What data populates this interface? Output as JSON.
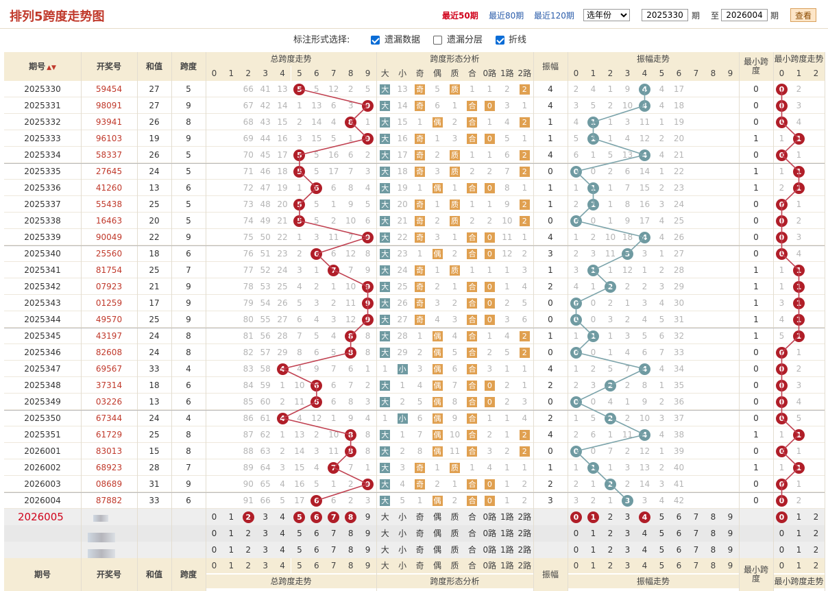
{
  "header": {
    "title": "排列5跨度走势图",
    "links": [
      "最近50期",
      "最近80期",
      "最近120期"
    ],
    "year_select": "选年份",
    "from_value": "2025330",
    "from_unit": "期",
    "to_label": "至",
    "to_value": "2026004",
    "to_unit": "期",
    "query_button": "查看"
  },
  "options": {
    "label": "标注形式选择:",
    "items": [
      {
        "label": "遗漏数据",
        "checked": true
      },
      {
        "label": "遗漏分层",
        "checked": false
      },
      {
        "label": "折线",
        "checked": true
      }
    ]
  },
  "columns": {
    "period": "期号",
    "draw": "开奖号",
    "sum": "和值",
    "span": "跨度",
    "span_trend": "总跨度走势",
    "shape": "跨度形态分析",
    "shape_cols": [
      "大",
      "小",
      "奇",
      "偶",
      "质",
      "合",
      "0路",
      "1路",
      "2路"
    ],
    "amplitude": "振幅",
    "amp_trend": "振幅走势",
    "min_span": "最小跨度",
    "min_trend": "最小跨度走势",
    "digits10": [
      "0",
      "1",
      "2",
      "3",
      "4",
      "5",
      "6",
      "7",
      "8",
      "9"
    ],
    "digits3": [
      "0",
      "1",
      "2"
    ]
  },
  "rows": [
    {
      "p": "2025330",
      "d": "59454",
      "s": "27",
      "k": "5",
      "m": [
        "66",
        "41",
        "13",
        "5",
        "12",
        "2",
        "5",
        "1"
      ],
      "sh": [
        "大",
        "13",
        "奇",
        "5",
        "质",
        "1",
        "1",
        "2",
        "2"
      ],
      "a": "4",
      "am": [
        "2",
        "4",
        "1",
        "9",
        "4",
        "17",
        "66"
      ],
      "n": "0",
      "nm": [
        "0",
        "2"
      ]
    },
    {
      "p": "2025331",
      "d": "98091",
      "s": "27",
      "k": "9",
      "m": [
        "67",
        "42",
        "14",
        "1",
        "13",
        "6",
        "3"
      ],
      "sh": [
        "大",
        "14",
        "奇",
        "6",
        "1",
        "合",
        "0",
        "3",
        "1"
      ],
      "a": "4",
      "am": [
        "3",
        "5",
        "2",
        "10",
        "4",
        "18",
        "67"
      ],
      "n": "0",
      "nm": [
        "0",
        "3"
      ]
    },
    {
      "p": "2025332",
      "d": "93941",
      "s": "26",
      "k": "8",
      "m": [
        "68",
        "43",
        "15",
        "2",
        "14",
        "4",
        "1"
      ],
      "sh": [
        "大",
        "15",
        "1",
        "偶",
        "2",
        "合",
        "1",
        "4",
        "2"
      ],
      "a": "1",
      "am": [
        "4",
        "1",
        "3",
        "11",
        "1",
        "19",
        "68"
      ],
      "n": "0",
      "nm": [
        "0",
        "4"
      ]
    },
    {
      "p": "2025333",
      "d": "96103",
      "s": "19",
      "k": "9",
      "m": [
        "69",
        "44",
        "16",
        "3",
        "15",
        "5",
        "1"
      ],
      "sh": [
        "大",
        "16",
        "奇",
        "1",
        "3",
        "合",
        "0",
        "5",
        "1"
      ],
      "a": "1",
      "am": [
        "5",
        "1",
        "4",
        "12",
        "2",
        "20",
        "69"
      ],
      "n": "1",
      "nm": [
        "1",
        "1"
      ]
    },
    {
      "p": "2025334",
      "d": "58337",
      "s": "26",
      "k": "5",
      "m": [
        "70",
        "45",
        "17",
        "5",
        "16",
        "6",
        "2",
        "1"
      ],
      "sh": [
        "大",
        "17",
        "奇",
        "2",
        "质",
        "1",
        "1",
        "6",
        "2"
      ],
      "a": "4",
      "am": [
        "6",
        "1",
        "5",
        "13",
        "4",
        "21",
        "70"
      ],
      "n": "0",
      "nm": [
        "0",
        "1"
      ]
    },
    {
      "p": "2025335",
      "d": "27645",
      "s": "24",
      "k": "5",
      "m": [
        "71",
        "46",
        "18",
        "5",
        "17",
        "7",
        "3",
        "2"
      ],
      "sh": [
        "大",
        "18",
        "奇",
        "3",
        "质",
        "2",
        "2",
        "7",
        "2"
      ],
      "a": "0",
      "am": [
        "0",
        "2",
        "6",
        "14",
        "1",
        "22",
        "71"
      ],
      "n": "1",
      "nm": [
        "1",
        "1"
      ]
    },
    {
      "p": "2025336",
      "d": "41260",
      "s": "13",
      "k": "6",
      "m": [
        "72",
        "47",
        "19",
        "1",
        "6",
        "8",
        "4",
        "3"
      ],
      "sh": [
        "大",
        "19",
        "1",
        "偶",
        "1",
        "合",
        "0",
        "8",
        "1"
      ],
      "a": "1",
      "am": [
        "1",
        "1",
        "7",
        "15",
        "2",
        "23",
        "72"
      ],
      "n": "1",
      "nm": [
        "2",
        "1"
      ]
    },
    {
      "p": "2025337",
      "d": "55438",
      "s": "25",
      "k": "5",
      "m": [
        "73",
        "48",
        "20",
        "5",
        "1",
        "9",
        "5",
        "4"
      ],
      "sh": [
        "大",
        "20",
        "奇",
        "1",
        "质",
        "1",
        "1",
        "9",
        "2"
      ],
      "a": "1",
      "am": [
        "2",
        "1",
        "8",
        "16",
        "3",
        "24",
        "73"
      ],
      "n": "0",
      "nm": [
        "0",
        "1"
      ]
    },
    {
      "p": "2025338",
      "d": "16463",
      "s": "20",
      "k": "5",
      "m": [
        "74",
        "49",
        "21",
        "5",
        "2",
        "10",
        "6",
        "5"
      ],
      "sh": [
        "大",
        "21",
        "奇",
        "2",
        "质",
        "2",
        "2",
        "10",
        "2"
      ],
      "a": "0",
      "am": [
        "0",
        "1",
        "9",
        "17",
        "4",
        "25",
        "74"
      ],
      "n": "0",
      "nm": [
        "0",
        "2"
      ]
    },
    {
      "p": "2025339",
      "d": "90049",
      "s": "22",
      "k": "9",
      "m": [
        "75",
        "50",
        "22",
        "1",
        "3",
        "11",
        "7"
      ],
      "sh": [
        "大",
        "22",
        "奇",
        "3",
        "1",
        "合",
        "0",
        "11",
        "1"
      ],
      "a": "4",
      "am": [
        "1",
        "2",
        "10",
        "18",
        "4",
        "26",
        "75"
      ],
      "n": "0",
      "nm": [
        "0",
        "3"
      ]
    },
    {
      "p": "2025340",
      "d": "25560",
      "s": "18",
      "k": "6",
      "m": [
        "76",
        "51",
        "23",
        "2",
        "6",
        "12",
        "8",
        "1"
      ],
      "sh": [
        "大",
        "23",
        "1",
        "偶",
        "2",
        "合",
        "0",
        "12",
        "2"
      ],
      "a": "3",
      "am": [
        "2",
        "3",
        "11",
        "3",
        "1",
        "27",
        "76"
      ],
      "n": "0",
      "nm": [
        "0",
        "4"
      ]
    },
    {
      "p": "2025341",
      "d": "81754",
      "s": "25",
      "k": "7",
      "m": [
        "77",
        "52",
        "24",
        "3",
        "1",
        "7",
        "9",
        "2"
      ],
      "sh": [
        "大",
        "24",
        "奇",
        "1",
        "质",
        "1",
        "1",
        "1",
        "3"
      ],
      "a": "1",
      "am": [
        "3",
        "1",
        "12",
        "1",
        "2",
        "28",
        "77"
      ],
      "n": "1",
      "nm": [
        "1",
        "1"
      ]
    },
    {
      "p": "2025342",
      "d": "07923",
      "s": "21",
      "k": "9",
      "m": [
        "78",
        "53",
        "25",
        "4",
        "2",
        "1",
        "10"
      ],
      "sh": [
        "大",
        "25",
        "奇",
        "2",
        "1",
        "合",
        "0",
        "1",
        "4"
      ],
      "a": "2",
      "am": [
        "4",
        "1",
        "2",
        "2",
        "3",
        "29",
        "78"
      ],
      "n": "1",
      "nm": [
        "1",
        "1"
      ]
    },
    {
      "p": "2025343",
      "d": "01259",
      "s": "17",
      "k": "9",
      "m": [
        "79",
        "54",
        "26",
        "5",
        "3",
        "2",
        "11"
      ],
      "sh": [
        "大",
        "26",
        "奇",
        "3",
        "2",
        "合",
        "0",
        "2",
        "5"
      ],
      "a": "0",
      "am": [
        "0",
        "2",
        "1",
        "3",
        "4",
        "30",
        "79"
      ],
      "n": "1",
      "nm": [
        "3",
        "1"
      ]
    },
    {
      "p": "2025344",
      "d": "49570",
      "s": "25",
      "k": "9",
      "m": [
        "80",
        "55",
        "27",
        "6",
        "4",
        "3",
        "12"
      ],
      "sh": [
        "大",
        "27",
        "奇",
        "4",
        "3",
        "合",
        "0",
        "3",
        "6"
      ],
      "a": "0",
      "am": [
        "0",
        "3",
        "2",
        "4",
        "5",
        "31",
        "80"
      ],
      "n": "1",
      "nm": [
        "4",
        "1"
      ]
    },
    {
      "p": "2025345",
      "d": "43197",
      "s": "24",
      "k": "8",
      "m": [
        "81",
        "56",
        "28",
        "7",
        "5",
        "4",
        "8"
      ],
      "sh": [
        "大",
        "28",
        "1",
        "偶",
        "4",
        "合",
        "1",
        "4",
        "2"
      ],
      "a": "1",
      "am": [
        "1",
        "1",
        "3",
        "5",
        "6",
        "32",
        "81"
      ],
      "n": "1",
      "nm": [
        "5",
        "1"
      ]
    },
    {
      "p": "2025346",
      "d": "82608",
      "s": "24",
      "k": "8",
      "m": [
        "82",
        "57",
        "29",
        "8",
        "6",
        "5",
        "8",
        "2"
      ],
      "sh": [
        "大",
        "29",
        "2",
        "偶",
        "5",
        "合",
        "2",
        "5",
        "2"
      ],
      "a": "0",
      "am": [
        "0",
        "1",
        "4",
        "6",
        "7",
        "33",
        "82"
      ],
      "n": "0",
      "nm": [
        "0",
        "1"
      ]
    },
    {
      "p": "2025347",
      "d": "69567",
      "s": "33",
      "k": "4",
      "m": [
        "83",
        "58",
        "4",
        "9",
        "7",
        "6",
        "1",
        "3"
      ],
      "sh": [
        "1",
        "小",
        "3",
        "偶",
        "6",
        "合",
        "3",
        "1",
        "1"
      ],
      "a": "4",
      "am": [
        "1",
        "2",
        "5",
        "7",
        "4",
        "34",
        "83"
      ],
      "n": "0",
      "nm": [
        "0",
        "2"
      ]
    },
    {
      "p": "2025348",
      "d": "37314",
      "s": "18",
      "k": "6",
      "m": [
        "84",
        "59",
        "1",
        "10",
        "6",
        "7",
        "2",
        "4"
      ],
      "sh": [
        "大",
        "1",
        "4",
        "偶",
        "7",
        "合",
        "0",
        "2",
        "1"
      ],
      "a": "2",
      "am": [
        "2",
        "3",
        "2",
        "8",
        "1",
        "35",
        "84"
      ],
      "n": "0",
      "nm": [
        "0",
        "3"
      ]
    },
    {
      "p": "2025349",
      "d": "03226",
      "s": "13",
      "k": "6",
      "m": [
        "85",
        "60",
        "2",
        "11",
        "6",
        "8",
        "3",
        "5"
      ],
      "sh": [
        "大",
        "2",
        "5",
        "偶",
        "8",
        "合",
        "0",
        "2",
        "3"
      ],
      "a": "0",
      "am": [
        "0",
        "4",
        "1",
        "9",
        "2",
        "36",
        "85"
      ],
      "n": "0",
      "nm": [
        "0",
        "4"
      ]
    },
    {
      "p": "2025350",
      "d": "67344",
      "s": "24",
      "k": "4",
      "m": [
        "86",
        "61",
        "4",
        "12",
        "1",
        "9",
        "4",
        "6"
      ],
      "sh": [
        "1",
        "小",
        "6",
        "偶",
        "9",
        "合",
        "1",
        "1",
        "4"
      ],
      "a": "2",
      "am": [
        "1",
        "5",
        "2",
        "10",
        "3",
        "37",
        "86"
      ],
      "n": "0",
      "nm": [
        "0",
        "5"
      ]
    },
    {
      "p": "2025351",
      "d": "61729",
      "s": "25",
      "k": "8",
      "m": [
        "87",
        "62",
        "1",
        "13",
        "2",
        "10",
        "8",
        "7"
      ],
      "sh": [
        "大",
        "1",
        "7",
        "偶",
        "10",
        "合",
        "2",
        "1",
        "2"
      ],
      "a": "4",
      "am": [
        "2",
        "6",
        "1",
        "11",
        "4",
        "38",
        "87"
      ],
      "n": "1",
      "nm": [
        "1",
        "1"
      ]
    },
    {
      "p": "2026001",
      "d": "83013",
      "s": "15",
      "k": "8",
      "m": [
        "88",
        "63",
        "2",
        "14",
        "3",
        "11",
        "8",
        "8"
      ],
      "sh": [
        "大",
        "2",
        "8",
        "偶",
        "11",
        "合",
        "3",
        "2",
        "2"
      ],
      "a": "0",
      "am": [
        "0",
        "7",
        "2",
        "12",
        "1",
        "39",
        "88"
      ],
      "n": "0",
      "nm": [
        "0",
        "1"
      ]
    },
    {
      "p": "2026002",
      "d": "68923",
      "s": "28",
      "k": "7",
      "m": [
        "89",
        "64",
        "3",
        "15",
        "4",
        "7",
        "1",
        "9"
      ],
      "sh": [
        "大",
        "3",
        "奇",
        "1",
        "质",
        "1",
        "4",
        "1",
        "1"
      ],
      "a": "1",
      "am": [
        "1",
        "1",
        "3",
        "13",
        "2",
        "40",
        "89"
      ],
      "n": "1",
      "nm": [
        "1",
        "1"
      ]
    },
    {
      "p": "2026003",
      "d": "08689",
      "s": "31",
      "k": "9",
      "m": [
        "90",
        "65",
        "4",
        "16",
        "5",
        "1",
        "2"
      ],
      "sh": [
        "大",
        "4",
        "奇",
        "2",
        "1",
        "合",
        "0",
        "1",
        "2"
      ],
      "a": "2",
      "am": [
        "2",
        "1",
        "2",
        "14",
        "3",
        "41",
        "90"
      ],
      "n": "0",
      "nm": [
        "0",
        "1"
      ]
    },
    {
      "p": "2026004",
      "d": "87882",
      "s": "33",
      "k": "6",
      "m": [
        "91",
        "66",
        "5",
        "17",
        "6",
        "2",
        "3",
        "1"
      ],
      "sh": [
        "大",
        "5",
        "1",
        "偶",
        "2",
        "合",
        "0",
        "1",
        "2"
      ],
      "a": "3",
      "am": [
        "3",
        "2",
        "1",
        "3",
        "4",
        "42",
        "91"
      ],
      "n": "0",
      "nm": [
        "0",
        "2"
      ]
    }
  ],
  "next_period": "2026005",
  "predict_span_balls": [
    "2",
    "5",
    "6",
    "7",
    "8"
  ],
  "predict_amp_balls": [
    "0",
    "1",
    "4"
  ],
  "predict_min_ball": "0",
  "colors": {
    "red": "#b01e28",
    "teal": "#6f9aa1",
    "orange": "#e0a050",
    "link": "#2a5caa",
    "header_bg": "#f5ecd5"
  }
}
